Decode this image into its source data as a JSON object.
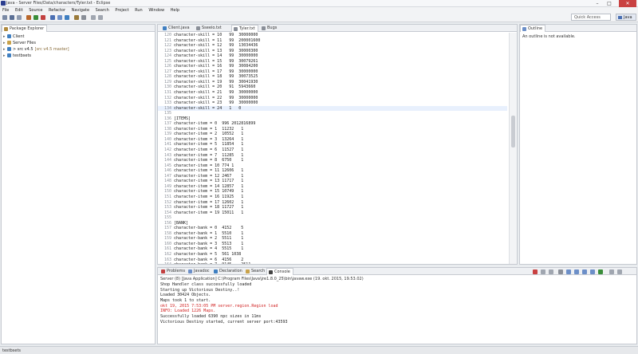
{
  "window": {
    "title": "Java - Server Files/Data/characters/Tyler.txt - Eclipse"
  },
  "menu": [
    "File",
    "Edit",
    "Source",
    "Refactor",
    "Navigate",
    "Search",
    "Project",
    "Run",
    "Window",
    "Help"
  ],
  "toolbar": {
    "quick_access": "Quick Access",
    "perspective": "Java"
  },
  "package_explorer": {
    "tab_label": "Package Explorer",
    "items": [
      {
        "label": "Client",
        "git": ""
      },
      {
        "label": "Server Files",
        "git": ""
      },
      {
        "label": "> src v4.5",
        "git": "[src v4.5 master]"
      },
      {
        "label": "testbsets",
        "git": ""
      }
    ]
  },
  "editor": {
    "tabs": [
      "Client.java",
      "Sseeio.txt",
      "Tyler.txt",
      "Bugs"
    ],
    "active_tab": 2,
    "current_line": 134,
    "lines": [
      [
        "120",
        "character-skill = 10   99  30000000"
      ],
      [
        "121",
        "character-skill = 11   99  200001600"
      ],
      [
        "122",
        "character-skill = 12   99  13034436"
      ],
      [
        "123",
        "character-skill = 13   99  30000300"
      ],
      [
        "124",
        "character-skill = 14   99  30000000"
      ],
      [
        "125",
        "character-skill = 15   99  30079261"
      ],
      [
        "126",
        "character-skill = 16   99  30084200"
      ],
      [
        "127",
        "character-skill = 17   99  30000000"
      ],
      [
        "128",
        "character-skill = 18   99  30073525"
      ],
      [
        "129",
        "character-skill = 19   99  30041930"
      ],
      [
        "130",
        "character-skill = 20   91  5943660"
      ],
      [
        "131",
        "character-skill = 21   99  30000000"
      ],
      [
        "132",
        "character-skill = 22   99  30000000"
      ],
      [
        "133",
        "character-skill = 23   99  30000000"
      ],
      [
        "134",
        "character-skill = 24   1   0"
      ],
      [
        "135",
        ""
      ],
      [
        "136",
        "[ITEMS]"
      ],
      [
        "137",
        "character-item = 0  996 2012816899"
      ],
      [
        "138",
        "character-item = 1  11232   1"
      ],
      [
        "139",
        "character-item = 2  10552   1"
      ],
      [
        "140",
        "character-item = 3  13264   1"
      ],
      [
        "141",
        "character-item = 5  11854   1"
      ],
      [
        "142",
        "character-item = 6  11527   1"
      ],
      [
        "143",
        "character-item = 7  11285   1"
      ],
      [
        "144",
        "character-item = 8  6750    1"
      ],
      [
        "145",
        "character-item = 10 774 1"
      ],
      [
        "146",
        "character-item = 11 12606   1"
      ],
      [
        "147",
        "character-item = 12 2467    1"
      ],
      [
        "148",
        "character-item = 13 11717   1"
      ],
      [
        "149",
        "character-item = 14 12857   1"
      ],
      [
        "150",
        "character-item = 15 10749   1"
      ],
      [
        "151",
        "character-item = 16 11925   1"
      ],
      [
        "152",
        "character-item = 17 12602   1"
      ],
      [
        "153",
        "character-item = 18 11727   1"
      ],
      [
        "154",
        "character-item = 19 15011   1"
      ],
      [
        "155",
        ""
      ],
      [
        "156",
        "[BANK]"
      ],
      [
        "157",
        "character-bank = 0  4152    5"
      ],
      [
        "158",
        "character-bank = 1  5510    1"
      ],
      [
        "159",
        "character-bank = 2  5511    1"
      ],
      [
        "160",
        "character-bank = 3  5513    1"
      ],
      [
        "161",
        "character-bank = 4  5515    1"
      ],
      [
        "162",
        "character-bank = 5  561 1038"
      ],
      [
        "163",
        "character-bank = 6  4156    2"
      ],
      [
        "164",
        "character-bank = 7  9145    2511"
      ]
    ]
  },
  "outline": {
    "tab_label": "Outline",
    "message": "An outline is not available."
  },
  "console": {
    "tabs": [
      "Problems",
      "Javadoc",
      "Declaration",
      "Search",
      "Console"
    ],
    "active_tab": 4,
    "launch": "Server (8) [Java Application] C:\\Program Files\\Java\\jre1.8.0_25\\bin\\javaw.exe (19. okt. 2015, 19.53.02)",
    "lines": [
      {
        "text": "Shop Handler class successfully loaded",
        "error": false
      },
      {
        "text": "Starting up Victorious Destiny..!",
        "error": false
      },
      {
        "text": "Loaded 30424 Objects.",
        "error": false
      },
      {
        "text": "Maps took 1 to start.",
        "error": false
      },
      {
        "text": "okt 19, 2015 7:53:05 PM server.region.Region load",
        "error": true
      },
      {
        "text": "INFO: Loaded 1226 Maps.",
        "error": true
      },
      {
        "text": "Successfully loaded 6390 npc sizes in 11ms",
        "error": false
      },
      {
        "text": "Victorious Destiny started, current server port:43593",
        "error": false
      }
    ]
  },
  "status_bar": {
    "text": "testbsets"
  },
  "colors": {
    "accent": "#4a6fb3",
    "error_text": "#d01f1f",
    "current_line": "#e8f0fd"
  }
}
